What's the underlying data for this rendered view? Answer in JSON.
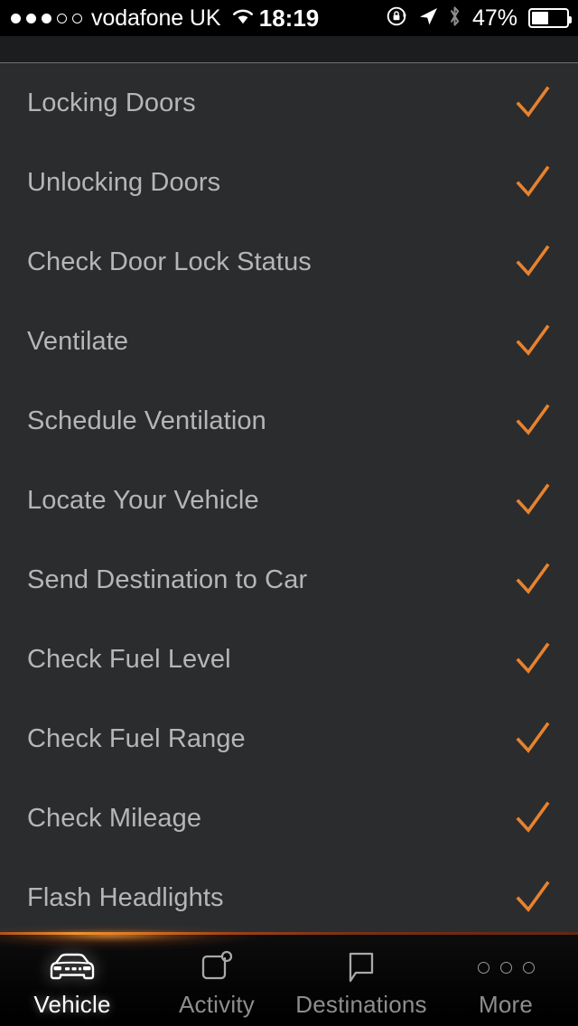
{
  "status_bar": {
    "signal_dots_filled": 3,
    "signal_dots_total": 5,
    "carrier": "vodafone UK",
    "wifi_icon": "wifi-icon",
    "time": "18:19",
    "rotation_lock_icon": "rotation-lock-icon",
    "location_icon": "location-arrow-icon",
    "bluetooth_icon": "bluetooth-icon",
    "battery_percent": "47%",
    "battery_level": 47
  },
  "feature_list": {
    "check_icon": "check-icon",
    "check_color": "#e8822e",
    "text_color": "#b5b6b8",
    "background_color": "#2b2c2e",
    "items": [
      {
        "label": "Locking Doors",
        "checked": true
      },
      {
        "label": "Unlocking Doors",
        "checked": true
      },
      {
        "label": "Check Door Lock Status",
        "checked": true
      },
      {
        "label": "Ventilate",
        "checked": true
      },
      {
        "label": "Schedule Ventilation",
        "checked": true
      },
      {
        "label": "Locate Your Vehicle",
        "checked": true
      },
      {
        "label": "Send Destination to Car",
        "checked": true
      },
      {
        "label": "Check Fuel Level",
        "checked": true
      },
      {
        "label": "Check Fuel Range",
        "checked": true
      },
      {
        "label": "Check Mileage",
        "checked": true
      },
      {
        "label": "Flash Headlights",
        "checked": true
      }
    ]
  },
  "tab_bar": {
    "accent_color": "#e8822e",
    "tabs": [
      {
        "label": "Vehicle",
        "icon": "car-front-icon",
        "active": true
      },
      {
        "label": "Activity",
        "icon": "activity-square-icon",
        "active": false
      },
      {
        "label": "Destinations",
        "icon": "speech-bubble-icon",
        "active": false
      },
      {
        "label": "More",
        "icon": "ellipsis-icon",
        "active": false
      }
    ]
  }
}
